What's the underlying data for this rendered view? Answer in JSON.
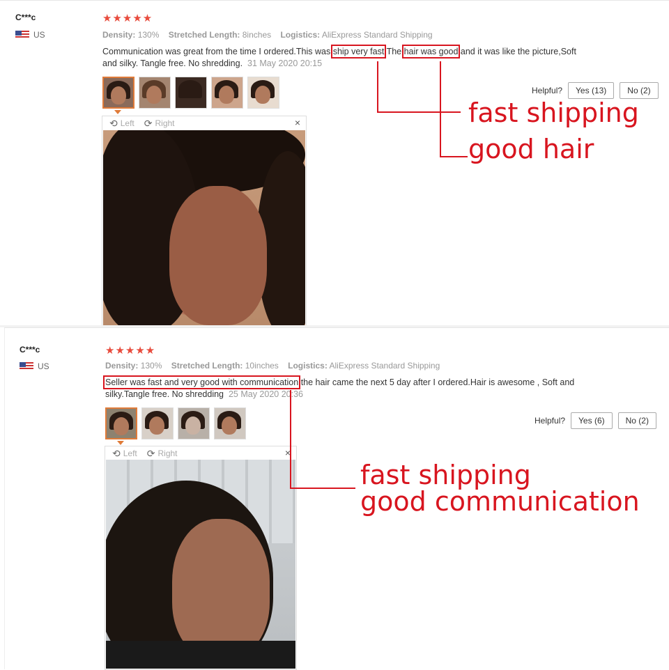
{
  "reviews": [
    {
      "user": "C***c",
      "country": "US",
      "stars": "★★★★★",
      "density_label": "Density:",
      "density_value": "130%",
      "length_label": "Stretched Length:",
      "length_value": "8inches",
      "logistics_label": "Logistics:",
      "logistics_value": "AliExpress Standard Shipping",
      "text_1": "Communication was great from the time I ordered.This was ",
      "highlight_1": "ship very fast",
      "text_2": " The ",
      "highlight_2": "hair was good",
      "text_3": " and it was like the picture,Soft and silky. Tangle free. No shredding.",
      "date": "31 May 2020 20:15",
      "helpful_label": "Helpful?",
      "yes_label": "Yes (13)",
      "no_label": "No (2)",
      "left_label": "Left",
      "right_label": "Right",
      "close_label": "×",
      "annotations": [
        "fast shipping",
        "good hair"
      ]
    },
    {
      "user": "C***c",
      "country": "US",
      "stars": "★★★★★",
      "density_label": "Density:",
      "density_value": "130%",
      "length_label": "Stretched Length:",
      "length_value": "10inches",
      "logistics_label": "Logistics:",
      "logistics_value": "AliExpress Standard Shipping",
      "highlight_1": "Seller was fast and very good with communication",
      "text_1": " the hair came the next 5 day after I ordered.Hair is awesome , Soft and silky.Tangle free. No shredding",
      "date": "25 May 2020 20:36",
      "helpful_label": "Helpful?",
      "yes_label": "Yes (6)",
      "no_label": "No (2)",
      "left_label": "Left",
      "right_label": "Right",
      "close_label": "×",
      "annotations": [
        "fast shipping",
        "good communication"
      ]
    }
  ],
  "colors": {
    "accent": "#d8151f",
    "stars": "#e84b3c",
    "thumb_active": "#e07b39"
  },
  "icons": [
    "rotate-left-icon",
    "rotate-right-icon",
    "close-icon",
    "us-flag-icon",
    "star-icon"
  ]
}
